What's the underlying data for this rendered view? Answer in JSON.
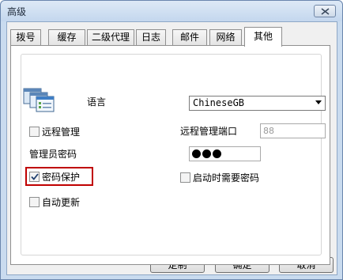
{
  "window": {
    "title": "高级"
  },
  "tabs": [
    {
      "label": "拨号",
      "active": false
    },
    {
      "label": "缓存",
      "active": false
    },
    {
      "label": "二级代理",
      "active": false
    },
    {
      "label": "日志",
      "active": false
    },
    {
      "label": "邮件",
      "active": false
    },
    {
      "label": "网络",
      "active": false
    },
    {
      "label": "其他",
      "active": true
    }
  ],
  "settings": {
    "language_label": "语言",
    "language_value": "ChineseGB",
    "remote_manage_label": "远程管理",
    "remote_manage_checked": false,
    "remote_port_label": "远程管理端口",
    "remote_port_value": "88",
    "admin_password_label": "管理员密码",
    "password_protect_label": "密码保护",
    "password_protect_checked": true,
    "startup_password_label": "启动时需要密码",
    "startup_password_checked": false,
    "auto_update_label": "自动更新",
    "auto_update_checked": false
  },
  "buttons": {
    "custom": "定制",
    "ok": "确定",
    "cancel": "取消"
  },
  "icons": {
    "close": "close-icon",
    "app": "app-windows-icon",
    "dropdown": "chevron-down-icon",
    "check": "check-icon"
  },
  "colors": {
    "highlight": "#c00000",
    "titlebar": "#c9dbef"
  }
}
